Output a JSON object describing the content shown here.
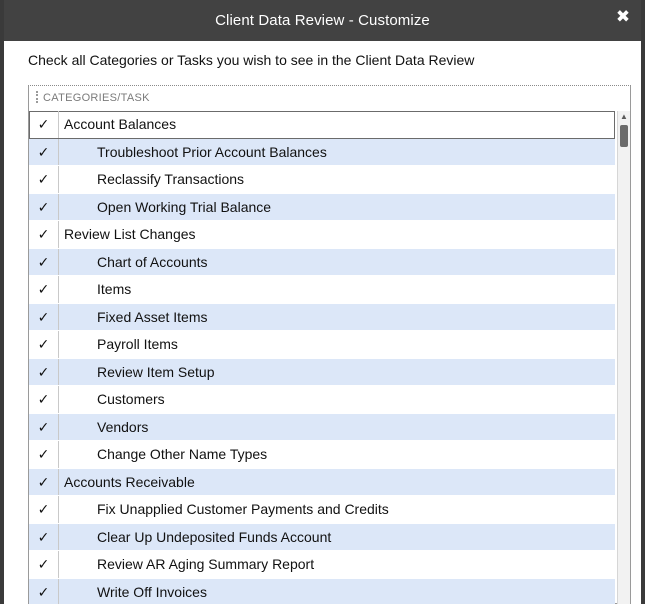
{
  "window": {
    "title": "Client Data Review - Customize",
    "close_glyph": "✖",
    "close_icon": "close-icon"
  },
  "instruction": "Check all Categories or Tasks you wish to see in the Client Data Review",
  "grid": {
    "column_header": "CATEGORIES/TASK",
    "check_glyph": "✓",
    "rows": [
      {
        "label": "Account Balances",
        "level": "category",
        "checked": true
      },
      {
        "label": "Troubleshoot Prior Account Balances",
        "level": "task",
        "checked": true
      },
      {
        "label": "Reclassify Transactions",
        "level": "task",
        "checked": true
      },
      {
        "label": "Open Working Trial Balance",
        "level": "task",
        "checked": true
      },
      {
        "label": "Review List Changes",
        "level": "category",
        "checked": true
      },
      {
        "label": "Chart of Accounts",
        "level": "task",
        "checked": true
      },
      {
        "label": "Items",
        "level": "task",
        "checked": true
      },
      {
        "label": "Fixed Asset Items",
        "level": "task",
        "checked": true
      },
      {
        "label": "Payroll Items",
        "level": "task",
        "checked": true
      },
      {
        "label": "Review Item Setup",
        "level": "task",
        "checked": true
      },
      {
        "label": "Customers",
        "level": "task",
        "checked": true
      },
      {
        "label": "Vendors",
        "level": "task",
        "checked": true
      },
      {
        "label": "Change Other Name Types",
        "level": "task",
        "checked": true
      },
      {
        "label": "Accounts Receivable",
        "level": "category",
        "checked": true
      },
      {
        "label": "Fix Unapplied Customer Payments and Credits",
        "level": "task",
        "checked": true
      },
      {
        "label": "Clear Up Undeposited Funds Account",
        "level": "task",
        "checked": true
      },
      {
        "label": "Review AR Aging Summary Report",
        "level": "task",
        "checked": true
      },
      {
        "label": "Write Off Invoices",
        "level": "task",
        "checked": true
      }
    ]
  },
  "scrollbar": {
    "up_glyph": "▲"
  },
  "colors": {
    "titlebar": "#424242",
    "row_alt": "#dce7f8",
    "border": "#9a9a9a"
  }
}
